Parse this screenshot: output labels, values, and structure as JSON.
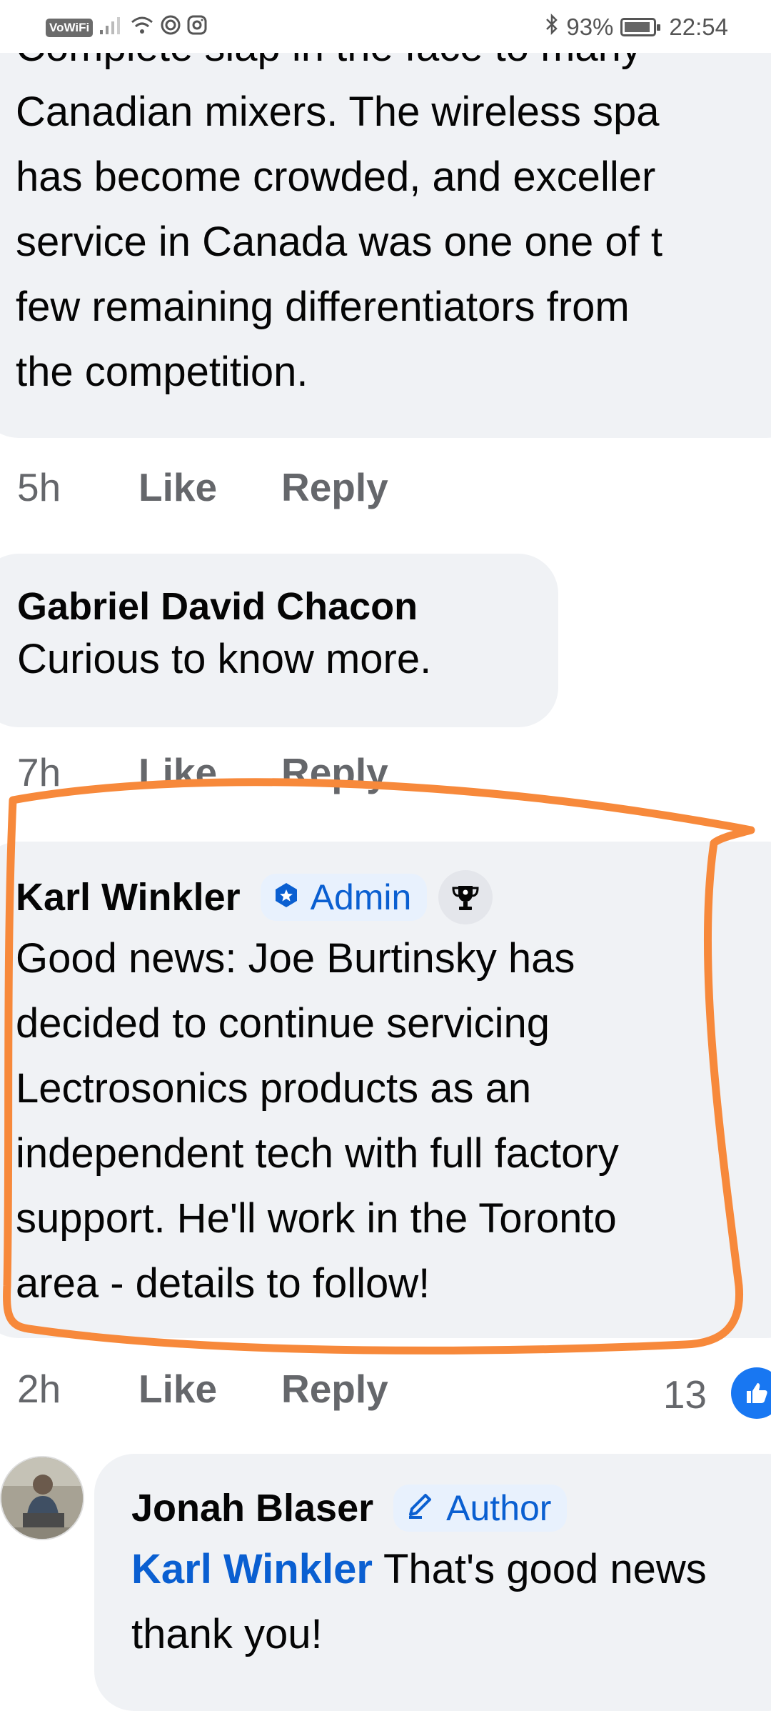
{
  "status_bar": {
    "vowifi": "VoWiFi",
    "battery_percent": "93%",
    "battery_level": 0.93,
    "time": "22:54",
    "icons": [
      "signal-icon",
      "wifi-icon",
      "hotspot-icon",
      "instagram-icon",
      "bluetooth-icon",
      "battery-icon"
    ]
  },
  "comment1": {
    "lines": [
      "Complete slap in the face to many",
      "Canadian mixers.  The wireless spa",
      "has become crowded, and exceller",
      "service in Canada was one one of t",
      "few remaining differentiators from",
      "the competition."
    ],
    "time": "5h",
    "like": "Like",
    "reply": "Reply"
  },
  "comment2": {
    "author": "Gabriel David Chacon",
    "text": "Curious to know more.",
    "time": "7h",
    "like": "Like",
    "reply": "Reply"
  },
  "comment3": {
    "author": "Karl Winkler",
    "badge": "Admin",
    "badge_icon": "admin-shield-icon",
    "trophy_icon": "trophy-icon",
    "lines": [
      "Good news: Joe Burtinsky has",
      "decided to continue servicing",
      "Lectrosonics products as an",
      "independent tech with full factory",
      "support. He'll work in the Toronto",
      "area - details to follow!"
    ],
    "time": "2h",
    "like": "Like",
    "reply": "Reply",
    "reaction_count": "13",
    "reaction_icon": "thumbs-up-icon"
  },
  "reply1": {
    "author": "Jonah Blaser",
    "badge": "Author",
    "badge_icon": "pencil-icon",
    "mention": "Karl Winkler",
    "text_line1": " That's good news",
    "text_line2": "thank you!"
  },
  "colors": {
    "bubble": "#f0f2f5",
    "link_blue": "#0a5fd1",
    "like_blue": "#1877f2",
    "annotation_orange": "#f7893b",
    "meta_gray": "#65676b"
  }
}
